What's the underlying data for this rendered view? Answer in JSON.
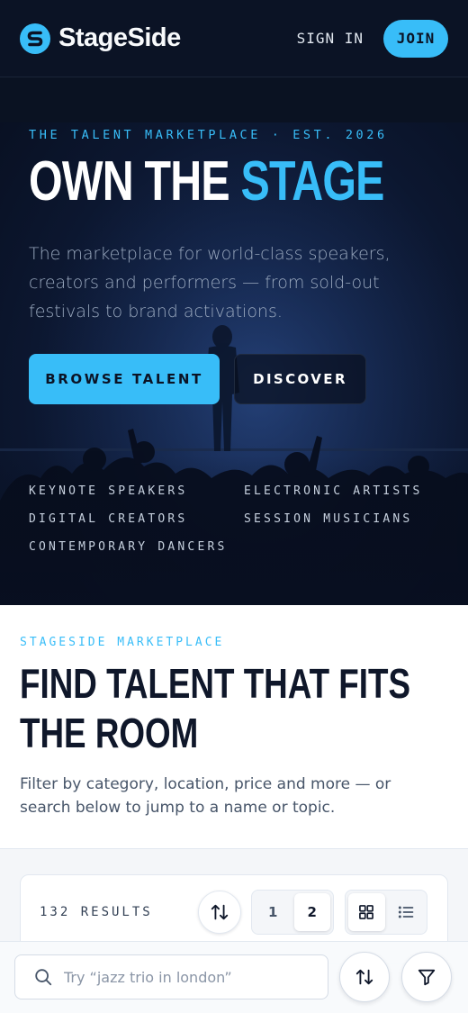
{
  "header": {
    "brand": "StageSide",
    "sign_in": "SIGN IN",
    "join": "JOIN"
  },
  "hero": {
    "eyebrow": "THE TALENT MARKETPLACE · EST. 2026",
    "title_plain": "OWN THE ",
    "title_accent": "STAGE",
    "description": "The marketplace for world-class speakers, creators and performers — from sold-out festivals to brand activations.",
    "primary_cta": "BROWSE TALENT",
    "secondary_cta": "DISCOVER",
    "categories": [
      "KEYNOTE SPEAKERS",
      "ELECTRONIC ARTISTS",
      "DIGITAL CREATORS",
      "SESSION MUSICIANS",
      "CONTEMPORARY DANCERS"
    ]
  },
  "marketplace": {
    "eyebrow": "STAGESIDE MARKETPLACE",
    "title": "FIND TALENT THAT FITS THE ROOM",
    "description": "Filter by category, location, price and more — or search below to jump to a name or topic."
  },
  "results": {
    "count_label": "132 RESULTS",
    "sort_icon": "sort-arrows-icon",
    "columns": [
      "1",
      "2"
    ],
    "active_column": "2",
    "views": [
      "grid-icon",
      "list-icon"
    ],
    "active_view": "grid-icon"
  },
  "bottom_bar": {
    "search_placeholder": "Try “jazz trio in london”",
    "search_value": "",
    "icons": [
      "search-icon",
      "sort-arrows-icon",
      "filter-icon"
    ]
  },
  "colors": {
    "accent": "#38bdf8",
    "header_bg": "#0b1325",
    "hero_bg": "#0c1730",
    "text_dark": "#0f172a"
  }
}
